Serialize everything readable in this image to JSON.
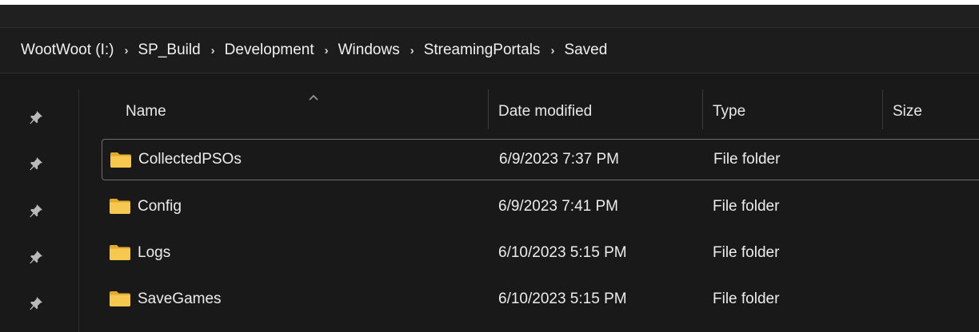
{
  "breadcrumb": {
    "items": [
      "WootWoot (I:)",
      "SP_Build",
      "Development",
      "Windows",
      "StreamingPortals",
      "Saved"
    ],
    "separator": "›"
  },
  "columns": {
    "name": "Name",
    "date_modified": "Date modified",
    "type": "Type",
    "size": "Size"
  },
  "files": [
    {
      "name": "CollectedPSOs",
      "date": "6/9/2023 7:37 PM",
      "type": "File folder",
      "selected": true
    },
    {
      "name": "Config",
      "date": "6/9/2023 7:41 PM",
      "type": "File folder",
      "selected": false
    },
    {
      "name": "Logs",
      "date": "6/10/2023 5:15 PM",
      "type": "File folder",
      "selected": false
    },
    {
      "name": "SaveGames",
      "date": "6/10/2023 5:15 PM",
      "type": "File folder",
      "selected": false
    }
  ],
  "colors": {
    "background": "#191919",
    "folder": "#f2c14f",
    "text": "#ececec"
  }
}
